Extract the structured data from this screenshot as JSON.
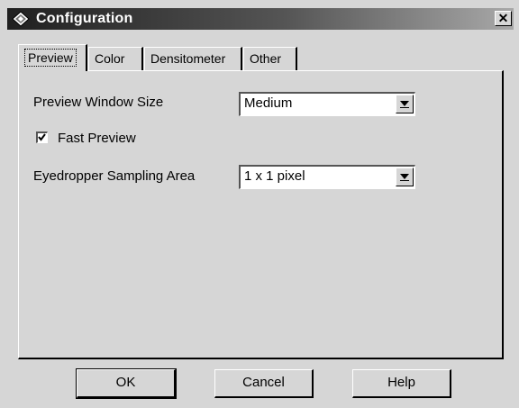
{
  "window": {
    "title": "Configuration",
    "close_glyph": "✕"
  },
  "tabs": [
    {
      "label": "Preview",
      "active": true
    },
    {
      "label": "Color",
      "active": false
    },
    {
      "label": "Densitometer",
      "active": false
    },
    {
      "label": "Other",
      "active": false
    }
  ],
  "preview_tab": {
    "window_size_label": "Preview Window Size",
    "window_size_value": "Medium",
    "fast_preview_label": "Fast Preview",
    "fast_preview_checked": true,
    "eyedropper_label": "Eyedropper Sampling Area",
    "eyedropper_value": "1 x 1 pixel"
  },
  "buttons": {
    "ok": "OK",
    "cancel": "Cancel",
    "help": "Help"
  },
  "colors": {
    "face": "#d6d6d6",
    "titlebar_dark": "#202020",
    "titlebar_light": "#a8a8a8"
  },
  "icons": {
    "app": "diamond-app-icon",
    "close": "close-icon",
    "dropdown": "chevron-down-icon",
    "check": "checkmark-icon"
  }
}
